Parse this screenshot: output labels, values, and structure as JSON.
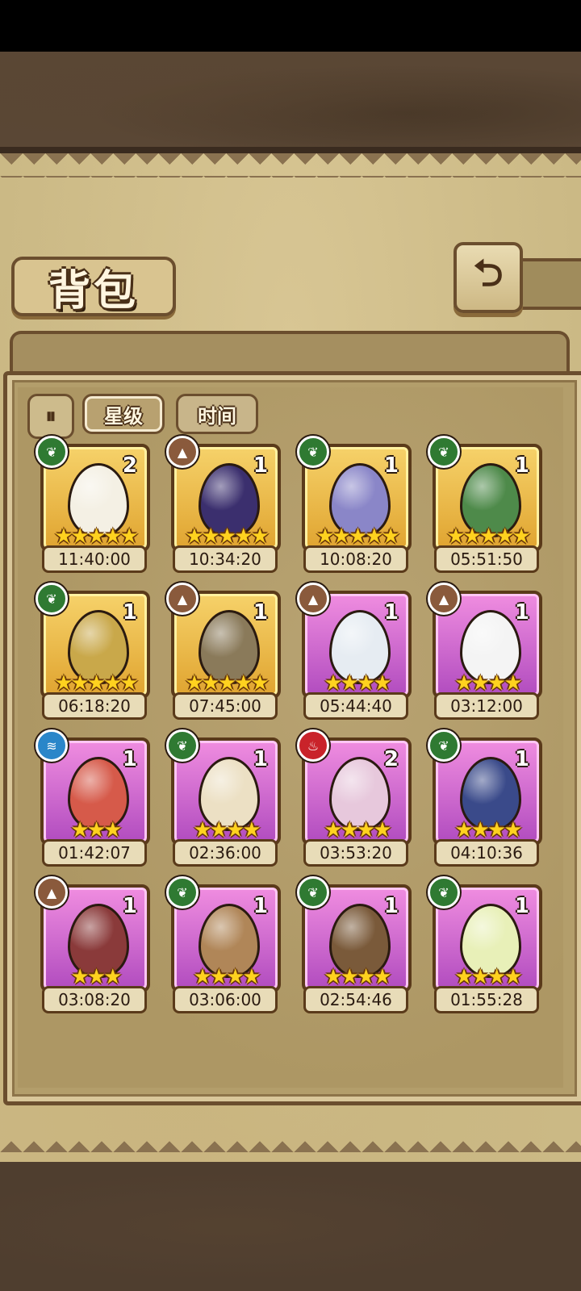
{
  "header": {
    "title": "背包"
  },
  "toolbar": {
    "toggle_label": "⏸",
    "tabs": [
      "星级",
      "时间"
    ]
  },
  "items": [
    {
      "element": "leaf",
      "count": "2",
      "stars": 5,
      "timer": "11:40:00",
      "frame": "gold",
      "egg": "#f4f0e4"
    },
    {
      "element": "rock",
      "count": "1",
      "stars": 5,
      "timer": "10:34:20",
      "frame": "gold",
      "egg": "#3b2f6e"
    },
    {
      "element": "leaf",
      "count": "1",
      "stars": 5,
      "timer": "10:08:20",
      "frame": "gold",
      "egg": "#8a86c8"
    },
    {
      "element": "leaf",
      "count": "1",
      "stars": 5,
      "timer": "05:51:50",
      "frame": "gold",
      "egg": "#4e8a4a"
    },
    {
      "element": "leaf",
      "count": "1",
      "stars": 5,
      "timer": "06:18:20",
      "frame": "gold",
      "egg": "#c9a84a"
    },
    {
      "element": "rock",
      "count": "1",
      "stars": 5,
      "timer": "07:45:00",
      "frame": "gold",
      "egg": "#8a7a5a"
    },
    {
      "element": "rock",
      "count": "1",
      "stars": 4,
      "timer": "05:44:40",
      "frame": "purple",
      "egg": "#e6ecf2"
    },
    {
      "element": "rock",
      "count": "1",
      "stars": 4,
      "timer": "03:12:00",
      "frame": "purple",
      "egg": "#f4f4f4"
    },
    {
      "element": "water",
      "count": "1",
      "stars": 3,
      "timer": "01:42:07",
      "frame": "purple",
      "egg": "#d65a4a"
    },
    {
      "element": "leaf",
      "count": "1",
      "stars": 4,
      "timer": "02:36:00",
      "frame": "purple",
      "egg": "#ece0c4"
    },
    {
      "element": "fire",
      "count": "2",
      "stars": 4,
      "timer": "03:53:20",
      "frame": "purple",
      "egg": "#e7c8dc"
    },
    {
      "element": "leaf",
      "count": "1",
      "stars": 4,
      "timer": "04:10:36",
      "frame": "purple",
      "egg": "#3a4a8a"
    },
    {
      "element": "rock",
      "count": "1",
      "stars": 3,
      "timer": "03:08:20",
      "frame": "purple",
      "egg": "#8a3a3a"
    },
    {
      "element": "leaf",
      "count": "1",
      "stars": 4,
      "timer": "03:06:00",
      "frame": "purple",
      "egg": "#b08658"
    },
    {
      "element": "leaf",
      "count": "1",
      "stars": 4,
      "timer": "02:54:46",
      "frame": "purple",
      "egg": "#7a5a3a"
    },
    {
      "element": "leaf",
      "count": "1",
      "stars": 4,
      "timer": "01:55:28",
      "frame": "purple",
      "egg": "#e8f0b8"
    }
  ]
}
